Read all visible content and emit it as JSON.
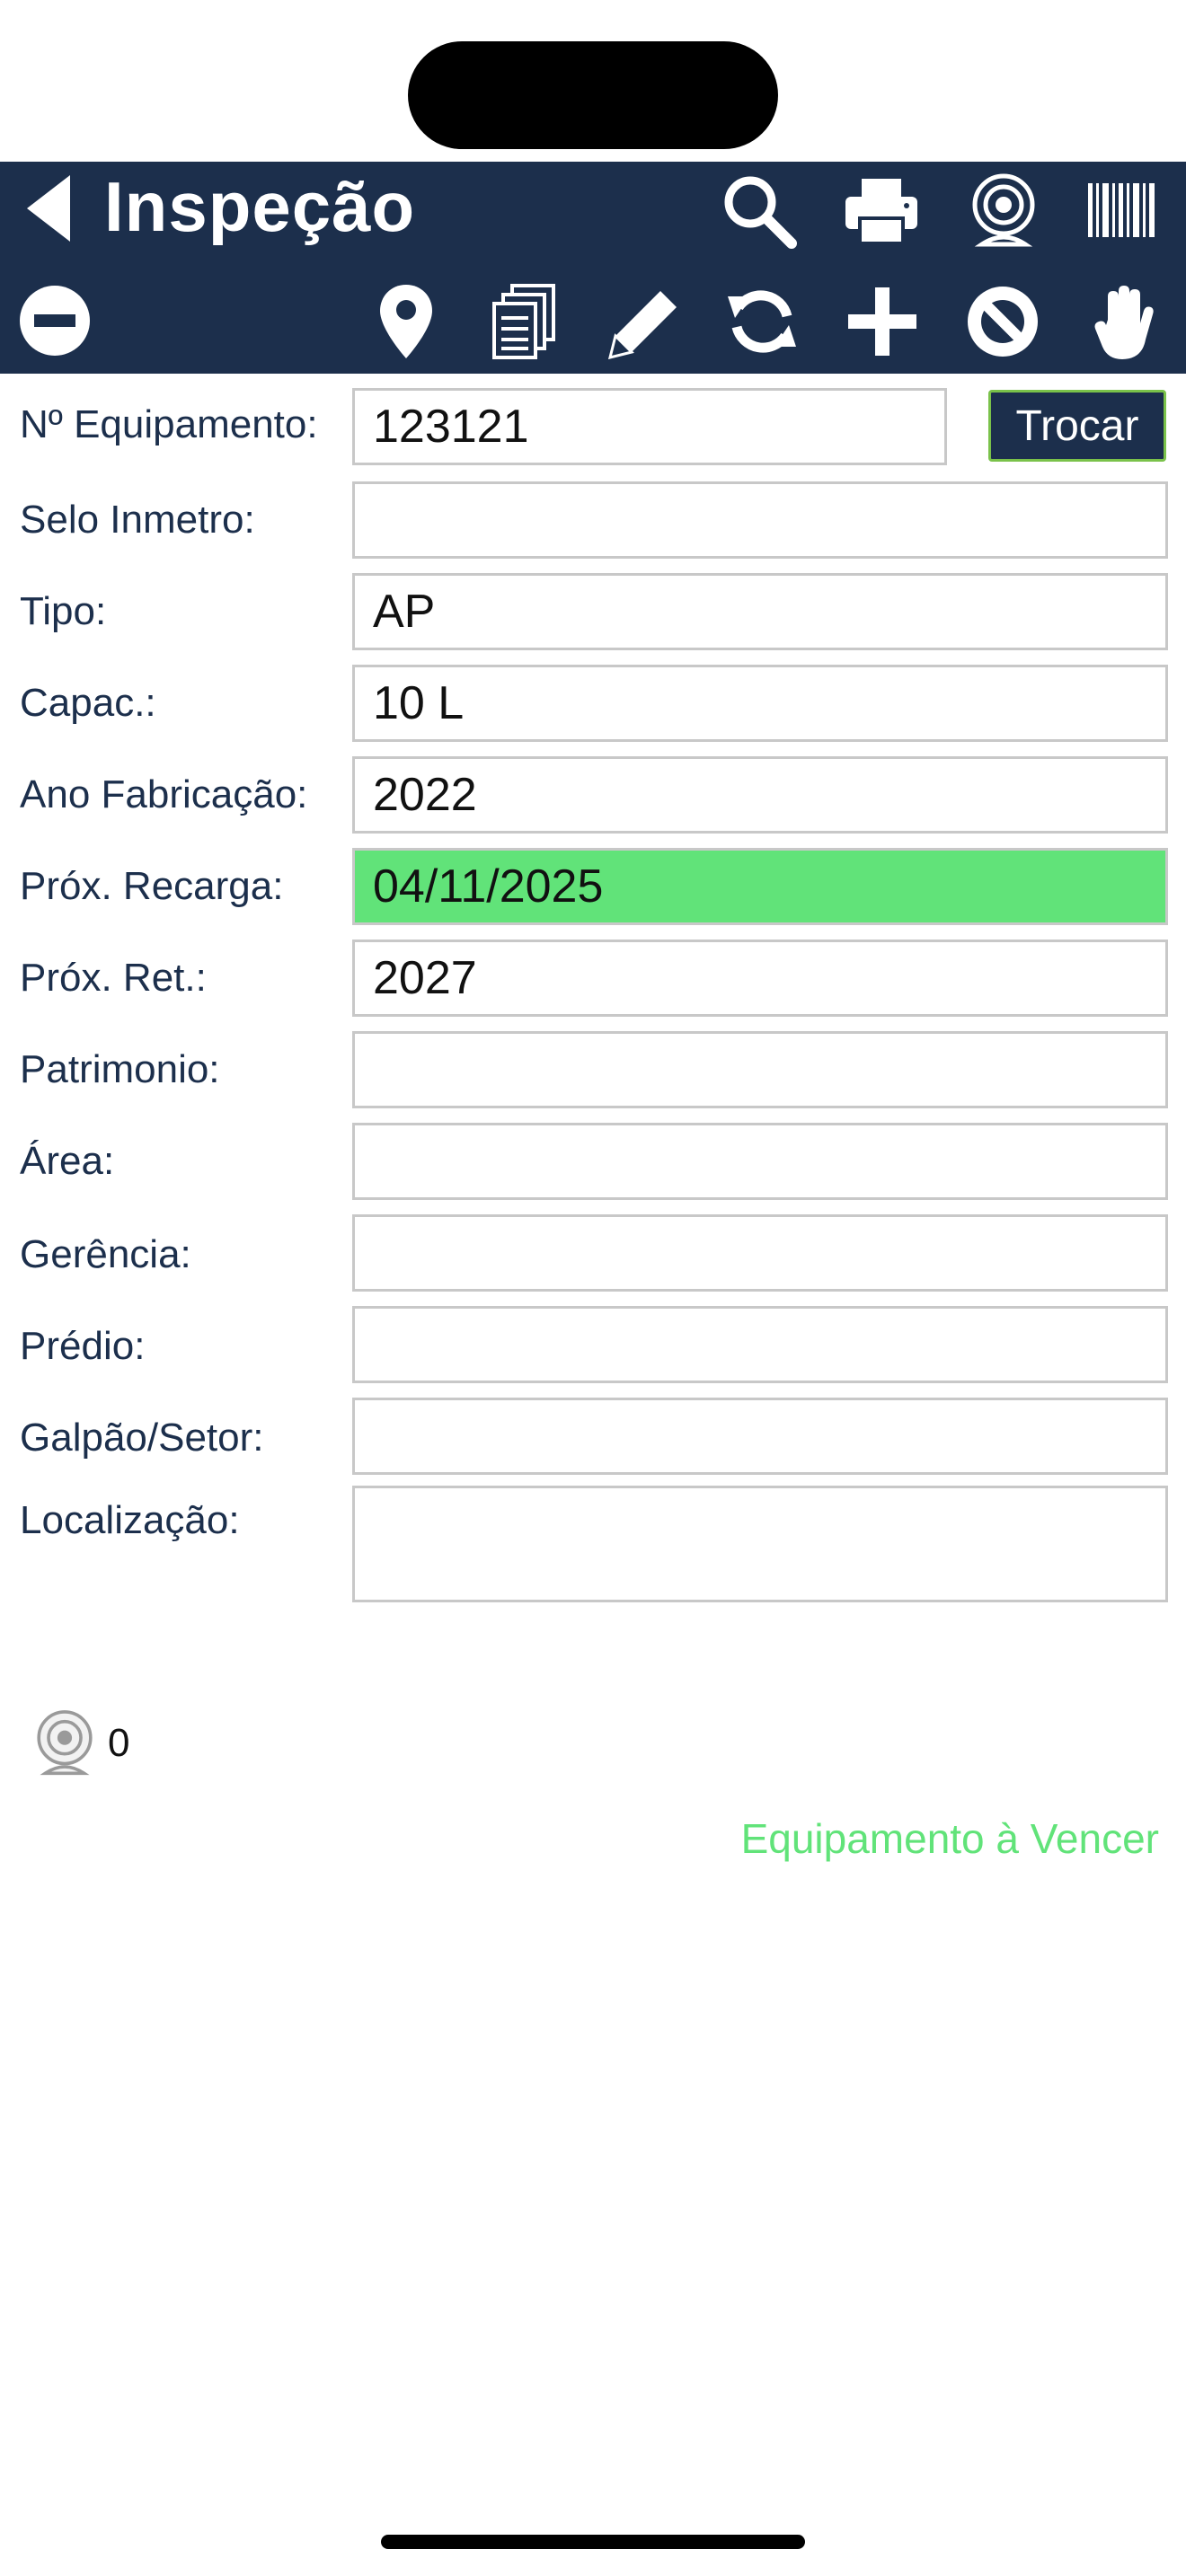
{
  "header": {
    "title": "Inspeção",
    "background_color": "#1c2f4c",
    "icons_row1": [
      "back-icon",
      "search-icon",
      "print-icon",
      "camera-icon",
      "barcode-icon"
    ],
    "icons_row2": [
      "minus-circle-icon",
      "map-pin-icon",
      "copy-icon",
      "pencil-icon",
      "refresh-icon",
      "plus-icon",
      "block-icon",
      "hand-icon"
    ]
  },
  "form": {
    "equipamento": {
      "label": "Nº Equipamento:",
      "value": "123121",
      "button": "Trocar"
    },
    "selo": {
      "label": "Selo Inmetro:",
      "value": ""
    },
    "tipo": {
      "label": "Tipo:",
      "value": "AP"
    },
    "capac": {
      "label": "Capac.:",
      "value": "10 L"
    },
    "ano": {
      "label": "Ano Fabricação:",
      "value": "2022"
    },
    "recarga": {
      "label": "Próx. Recarga:",
      "value": "04/11/2025",
      "highlight_color": "#61e379"
    },
    "ret": {
      "label": "Próx. Ret.:",
      "value": "2027"
    },
    "patrimonio": {
      "label": "Patrimonio:",
      "value": ""
    },
    "area": {
      "label": "Área:",
      "value": ""
    },
    "gerencia": {
      "label": "Gerência:",
      "value": ""
    },
    "predio": {
      "label": "Prédio:",
      "value": ""
    },
    "galpao": {
      "label": "Galpão/Setor:",
      "value": ""
    },
    "localizacao": {
      "label": "Localização:",
      "value": ""
    }
  },
  "photos": {
    "count": "0"
  },
  "status": {
    "text": "Equipamento à Vencer",
    "color": "#61e379"
  }
}
